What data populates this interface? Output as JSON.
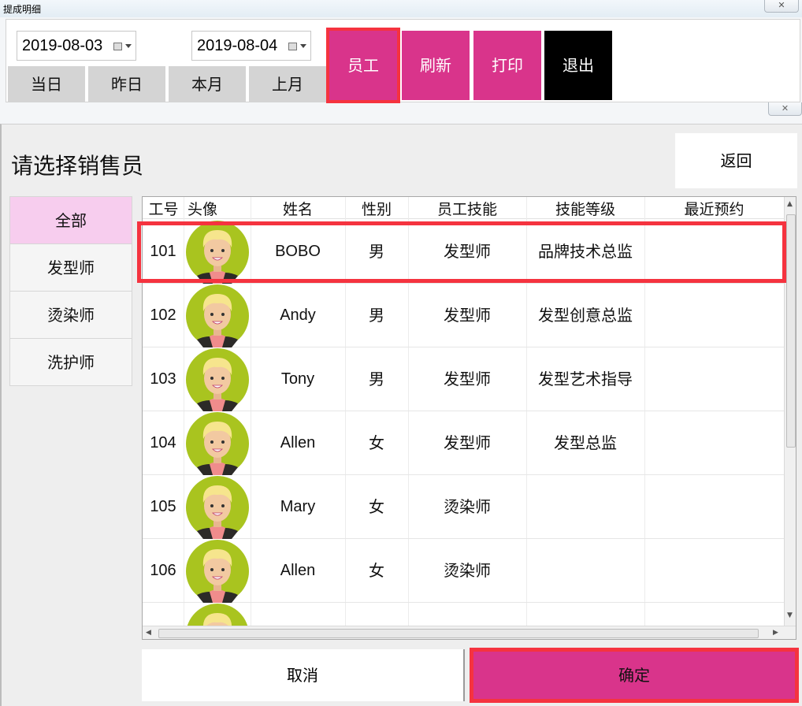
{
  "background_window": {
    "title": "提成明细",
    "close_glyph": "✕",
    "start_date": "2019-08-03",
    "end_date": "2019-08-04",
    "quick_ranges": [
      "当日",
      "昨日",
      "本月",
      "上月"
    ],
    "actions": {
      "staff": "员工",
      "refresh": "刷新",
      "print": "打印",
      "exit": "退出"
    }
  },
  "dialog": {
    "close_glyph": "✕",
    "title": "请选择销售员",
    "back_label": "返回",
    "categories": [
      "全部",
      "发型师",
      "烫染师",
      "洗护师"
    ],
    "selected_category": "全部",
    "columns": [
      "工号",
      "头像",
      "姓名",
      "性别",
      "员工技能",
      "技能等级",
      "最近预约"
    ],
    "rows": [
      {
        "id": "101",
        "name": "BOBO",
        "gender": "男",
        "skill": "发型师",
        "level": "品牌技术总监",
        "recent": ""
      },
      {
        "id": "102",
        "name": "Andy",
        "gender": "男",
        "skill": "发型师",
        "level": "发型创意总监",
        "recent": ""
      },
      {
        "id": "103",
        "name": "Tony",
        "gender": "男",
        "skill": "发型师",
        "level": "发型艺术指导",
        "recent": ""
      },
      {
        "id": "104",
        "name": "Allen",
        "gender": "女",
        "skill": "发型师",
        "level": "发型总监",
        "recent": ""
      },
      {
        "id": "105",
        "name": "Mary",
        "gender": "女",
        "skill": "烫染师",
        "level": "",
        "recent": ""
      },
      {
        "id": "106",
        "name": "Allen",
        "gender": "女",
        "skill": "烫染师",
        "level": "",
        "recent": ""
      },
      {
        "id": "",
        "name": "",
        "gender": "",
        "skill": "",
        "level": "",
        "recent": ""
      }
    ],
    "selected_row_id": "101",
    "scroll_up_glyph": "▲",
    "scroll_down_glyph": "▼",
    "scroll_left_glyph": "◀",
    "scroll_right_glyph": "▶",
    "cancel_label": "取消",
    "confirm_label": "确定"
  },
  "colors": {
    "accent_pink": "#d9348b",
    "highlight_red": "#f5333f",
    "selected_category_bg": "#f7cdee",
    "avatar_green": "#a9c41f"
  },
  "icons": {
    "date_picker": "calendar-icon",
    "avatar": "avatar-icon"
  }
}
